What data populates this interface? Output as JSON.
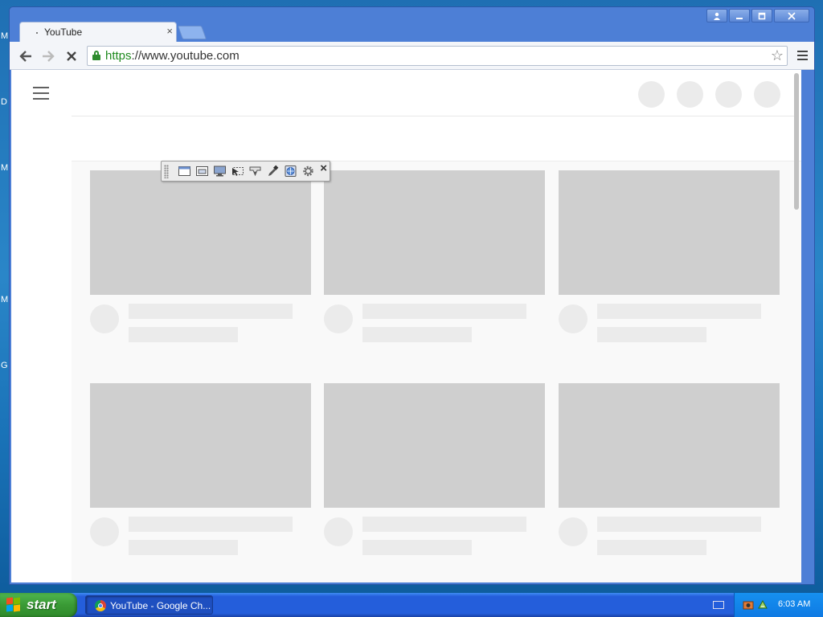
{
  "desktop": {
    "edge_letters": [
      "M",
      "D",
      "M",
      "M",
      "G"
    ]
  },
  "browser": {
    "tab_title": "YouTube",
    "tab_close": "×",
    "url_scheme": "https",
    "url_rest": "://www.youtube.com",
    "window_controls": [
      "user",
      "minimize",
      "maximize",
      "close"
    ]
  },
  "page": {
    "header_circles": 4,
    "video_placeholders": 6
  },
  "floating_toolbar": {
    "tools": [
      "window-icon",
      "window-inner-icon",
      "monitor-icon",
      "select-region-icon",
      "ruler-icon",
      "eyedropper-icon",
      "globe-icon",
      "gear-icon"
    ],
    "close": "×"
  },
  "taskbar": {
    "start_label": "start",
    "task_label": "YouTube - Google Ch...",
    "clock": "6:03 AM"
  }
}
